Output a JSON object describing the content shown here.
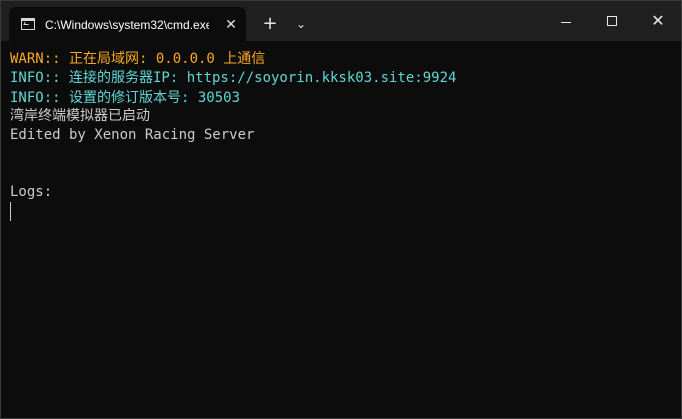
{
  "window": {
    "tab_title": "C:\\Windows\\system32\\cmd.exe",
    "tab_icon": "terminal-icon",
    "close_tab_glyph": "✕",
    "new_tab_glyph": "+",
    "dropdown_glyph": "⌄",
    "close_window_glyph": "✕"
  },
  "terminal": {
    "lines": [
      {
        "text": "WARN:: 正在局域网: 0.0.0.0 上通信",
        "level": "warn",
        "color": "#f9a825"
      },
      {
        "text": "INFO:: 连接的服务器IP: https://soyorin.kksk03.site:9924",
        "level": "info",
        "color": "#61d6d6"
      },
      {
        "text": "INFO:: 设置的修订版本号: 30503",
        "level": "info",
        "color": "#61d6d6"
      },
      {
        "text": "湾岸终端模拟器已启动",
        "level": "plain",
        "color": "#cccccc"
      },
      {
        "text": "Edited by Xenon Racing Server",
        "level": "plain",
        "color": "#cccccc"
      },
      {
        "text": "Logs:",
        "level": "plain",
        "color": "#cccccc"
      }
    ]
  },
  "colors": {
    "titlebar": "#202020",
    "background": "#0c0c0c",
    "warn": "#f9a825",
    "info": "#61d6d6",
    "text": "#cccccc"
  }
}
